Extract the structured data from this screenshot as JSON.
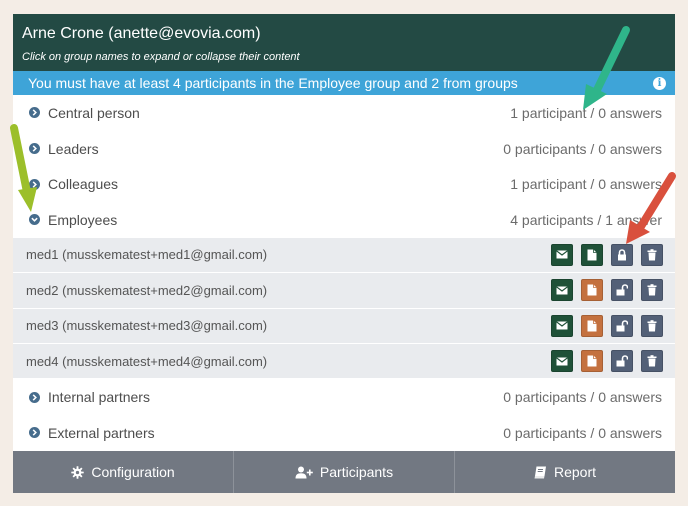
{
  "header": {
    "title": "Arne Crone (anette@evovia.com)",
    "subtitle": "Click on group names to expand or collapse their content"
  },
  "notice": {
    "text": "You must have at least 4 participants in the Employee group and 2 from groups"
  },
  "groups": [
    {
      "name": "Central person",
      "count": "1 participant / 0 answers"
    },
    {
      "name": "Leaders",
      "count": "0 participants / 0 answers"
    },
    {
      "name": "Colleagues",
      "count": "1 participant / 0 answers"
    },
    {
      "name": "Employees",
      "count": "4 participants / 1 answer",
      "expanded": true
    },
    {
      "name": "Internal partners",
      "count": "0 participants / 0 answers"
    },
    {
      "name": "External partners",
      "count": "0 participants / 0 answers"
    }
  ],
  "members": [
    {
      "label": "med1 (musskematest+med1@gmail.com)",
      "locked": true
    },
    {
      "label": "med2 (musskematest+med2@gmail.com)",
      "locked": false
    },
    {
      "label": "med3 (musskematest+med3@gmail.com)",
      "locked": false
    },
    {
      "label": "med4 (musskematest+med4@gmail.com)",
      "locked": false
    }
  ],
  "member_icons": [
    "envelope-icon",
    "document-icon",
    "lock-icon",
    "trash-icon"
  ],
  "footer": {
    "configuration": "Configuration",
    "participants": "Participants",
    "report": "Report"
  },
  "colors": {
    "header_bg": "#234a44",
    "notice_bg": "#3ea4d8",
    "footer_bg": "#727882",
    "email_button": "#1f5138",
    "report_button_completed": "#1f5138",
    "report_button_pending": "#c4713f",
    "lock_button": "#536077",
    "arrow_green": "#2fb58a",
    "arrow_yellow": "#9cbf2a",
    "arrow_red": "#d9503d"
  }
}
